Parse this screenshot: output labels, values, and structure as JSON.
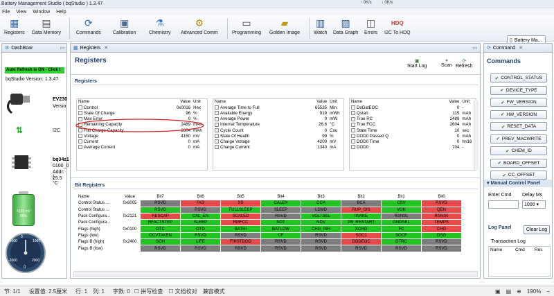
{
  "window": {
    "title": "Battery Management Studio ( bqStudio ) 1.3.47"
  },
  "netmon": {
    "up": "0K/s",
    "down": "0K/s"
  },
  "menu": [
    "File",
    "View",
    "Window",
    "Help"
  ],
  "toolbar": {
    "buttons": [
      {
        "label": "Registers",
        "icon": "registers-icon"
      },
      {
        "label": "Data Memory",
        "icon": "data-memory-icon"
      },
      {
        "label": "Commands",
        "icon": "commands-icon"
      },
      {
        "label": "Calibration",
        "icon": "calibration-icon"
      },
      {
        "label": "Chemistry",
        "icon": "chemistry-icon"
      },
      {
        "label": "Advanced Comm",
        "icon": "advanced-comm-icon"
      },
      {
        "label": "Programming",
        "icon": "programming-icon"
      },
      {
        "label": "Golden Image",
        "icon": "golden-image-icon"
      },
      {
        "label": "Watch",
        "icon": "watch-icon"
      },
      {
        "label": "Data Graph",
        "icon": "data-graph-icon"
      },
      {
        "label": "Errors",
        "icon": "errors-icon"
      },
      {
        "label": "I2C To HDQ",
        "icon": "i2c-hdq-icon"
      }
    ],
    "device_button": "Battery Ma..."
  },
  "dashboard": {
    "tab": "DashBoar",
    "auto_refresh": "Auto Refresh is ON - Click t",
    "version": "bqStudio Version:  1.3.47",
    "ev_line1": "EV230",
    "ev_line2": "Versio",
    "i2c": "I2C",
    "bq_line1": "bq34z1",
    "bq_line2": "0100_0",
    "bq_line3": "Addr: (",
    "bq_line4": "25.5 °C",
    "battery_mv": "4150 mV",
    "battery_pct": "96%",
    "gauge_labels": [
      "-1000",
      "0",
      "1000",
      "2000",
      "-2000"
    ],
    "gauge_value": "0"
  },
  "registers": {
    "tab": "Registers",
    "title": "Registers",
    "start_log": "Start Log",
    "scan": "Scan",
    "refresh": "Refresh",
    "section_registers": "Registers",
    "headers": [
      "Name",
      "Value",
      "Unit"
    ],
    "col1": [
      [
        "Control",
        "0x0016",
        "Hex"
      ],
      [
        "State Of Charge",
        "96",
        "%"
      ],
      [
        "Max Error",
        "0",
        "%"
      ],
      [
        "Remaining Capacity",
        "2489",
        "mAh"
      ],
      [
        "Full Charge Capacity",
        "2604",
        "mAh"
      ],
      [
        "Voltage",
        "4150",
        "mV"
      ],
      [
        "Current",
        "0",
        "mA"
      ],
      [
        "Average Current",
        "0",
        "mA"
      ]
    ],
    "col2": [
      [
        "Average Time to Full",
        "65535",
        "Min"
      ],
      [
        "Available Energy",
        "919",
        "mWh"
      ],
      [
        "Average Power",
        "0",
        "mW"
      ],
      [
        "Internal Temperature",
        "26.6",
        "°C"
      ],
      [
        "Cycle Count",
        "0",
        "Cou"
      ],
      [
        "State Of Health",
        "99",
        "%"
      ],
      [
        "Charge Voltage",
        "4200",
        "mV"
      ],
      [
        "Charge Current",
        "1340",
        "mA"
      ]
    ],
    "col3": [
      [
        "DoDatEOC",
        "0",
        "-"
      ],
      [
        "Qstart",
        "115",
        "mAh"
      ],
      [
        "True RC",
        "2489",
        "mAh"
      ],
      [
        "True FCC",
        "2604",
        "mAh"
      ],
      [
        "State Time",
        "10",
        "sec"
      ],
      [
        "DOD0 Passed Q",
        "0",
        "mAh"
      ],
      [
        "DOD0 Time",
        "0",
        "hr/16"
      ],
      [
        "DOD0",
        "704",
        "-"
      ]
    ],
    "section_bits": "Bit Registers",
    "bit_headers": [
      "Name",
      "Value",
      "Bit7",
      "Bit6",
      "Bit5",
      "Bit4",
      "Bit3",
      "Bit2",
      "Bit1",
      "Bit0"
    ],
    "bit_rows": [
      {
        "name": "Control Status ...",
        "value": "0x6005",
        "bits": [
          [
            "RSVD",
            "grey"
          ],
          [
            "FAS",
            "red"
          ],
          [
            "SS",
            "red"
          ],
          [
            "CALEN",
            "green"
          ],
          [
            "CCA",
            "green"
          ],
          [
            "BCA",
            "grey"
          ],
          [
            "CSV",
            "green"
          ],
          [
            "RSVD",
            "red"
          ]
        ]
      },
      {
        "name": "Control Status ...",
        "value": "",
        "bits": [
          [
            "RSVD",
            "green"
          ],
          [
            "RSVD",
            "grey"
          ],
          [
            "FULLSLEEP",
            "green"
          ],
          [
            "SLEEP",
            "grey"
          ],
          [
            "LDMD",
            "grey"
          ],
          [
            "RUP_DIS",
            "red"
          ],
          [
            "VOK",
            "green"
          ],
          [
            "QEN",
            "red"
          ]
        ]
      },
      {
        "name": "Pack Configura...",
        "value": "0x2121",
        "bits": [
          [
            "RESCAP",
            "red"
          ],
          [
            "CAL_EN",
            "green"
          ],
          [
            "SCALED",
            "red"
          ],
          [
            "RSVD",
            "grey"
          ],
          [
            "VOLTSEL",
            "green"
          ],
          [
            "IWAKE",
            "green"
          ],
          [
            "RSNS1",
            "grey"
          ],
          [
            "RSNS0",
            "red"
          ]
        ]
      },
      {
        "name": "Pack Configura...",
        "value": "",
        "bits": [
          [
            "RFACTSTEP",
            "green"
          ],
          [
            "SLEEP",
            "green"
          ],
          [
            "RMFCC",
            "red"
          ],
          [
            "NDT",
            "green"
          ],
          [
            "NDV",
            "green"
          ],
          [
            "PB_RESTART",
            "green"
          ],
          [
            "GNDSEL",
            "green"
          ],
          [
            "TEMPS",
            "red"
          ]
        ]
      },
      {
        "name": "Flags (high)",
        "value": "0x0100",
        "bits": [
          [
            "OTC",
            "green"
          ],
          [
            "OTD",
            "green"
          ],
          [
            "BATHI",
            "green"
          ],
          [
            "BATLOW",
            "green"
          ],
          [
            "CHG_INH",
            "green"
          ],
          [
            "XCHG",
            "green"
          ],
          [
            "FC",
            "green"
          ],
          [
            "CHG",
            "red"
          ]
        ]
      },
      {
        "name": "Flags (low)",
        "value": "",
        "bits": [
          [
            "OCVTAKEN",
            "green"
          ],
          [
            "RSVD",
            "green"
          ],
          [
            "RSVD",
            "grey"
          ],
          [
            "CF",
            "green"
          ],
          [
            "RSVD",
            "grey"
          ],
          [
            "SOC1",
            "red"
          ],
          [
            "SOCF",
            "green"
          ],
          [
            "DSG",
            "green"
          ]
        ]
      },
      {
        "name": "Flags B (high)",
        "value": "0x2400",
        "bits": [
          [
            "SOH",
            "green"
          ],
          [
            "LIFE",
            "green"
          ],
          [
            "FIRSTDOD",
            "red"
          ],
          [
            "RSVD",
            "grey"
          ],
          [
            "RSVD",
            "grey"
          ],
          [
            "DODEOC",
            "red"
          ],
          [
            "DTRC",
            "green"
          ],
          [
            "RSVD",
            "grey"
          ]
        ]
      },
      {
        "name": "Flags B (low)",
        "value": "",
        "bits": [
          [
            "RSVD",
            "grey"
          ],
          [
            "RSVD",
            "grey"
          ],
          [
            "RSVD",
            "grey"
          ],
          [
            "RSVD",
            "grey"
          ],
          [
            "RSVD",
            "grey"
          ],
          [
            "RSVD",
            "grey"
          ],
          [
            "RSVD",
            "grey"
          ],
          [
            "RSVD",
            "grey"
          ]
        ]
      }
    ]
  },
  "command_panel": {
    "tab": "Command",
    "title": "Commands",
    "buttons": [
      "CONTROL_STATUS",
      "DEVICE_TYPE",
      "FW_VERSION",
      "HW_VERSION",
      "RESET_DATA",
      "PREV_MACWRITE",
      "CHEM_ID",
      "BOARD_OFFSET",
      "CC_OFFSET"
    ],
    "manual_title": "Manual Control Panel",
    "enter_cmd": "Enter Cmd",
    "delay_ms": "Delay Ms",
    "delay_value": "1000",
    "log_title": "Log Panel",
    "clear_log": "Clear Log",
    "transaction_log": "Transaction Log",
    "log_headers": [
      "Name",
      "Cmd",
      "Res"
    ]
  },
  "statusbar": {
    "items": [
      "节: 1/1",
      "设置值: 2.5厘米",
      "行: 1",
      "列: 1",
      "字数: 0",
      "拼写检查",
      "文档校对",
      "兼容模式"
    ],
    "zoom": "190%"
  }
}
